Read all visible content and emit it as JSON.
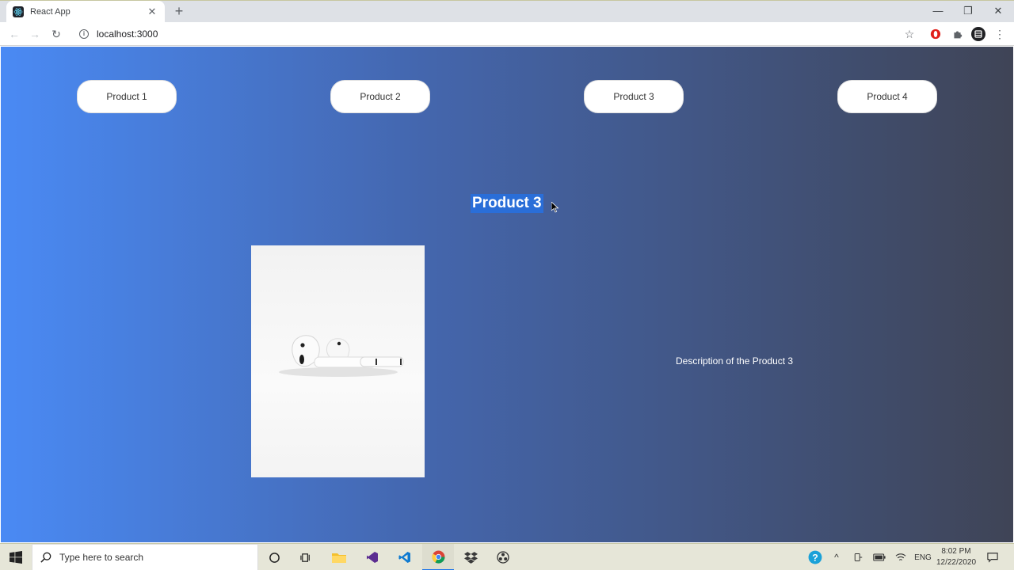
{
  "browser": {
    "tab_title": "React App",
    "tab_close": "✕",
    "new_tab": "+",
    "url": "localhost:3000",
    "window_controls": {
      "minimize": "—",
      "restore": "❐",
      "close": "✕"
    }
  },
  "page": {
    "nav_buttons": [
      {
        "label": "Product 1"
      },
      {
        "label": "Product 2"
      },
      {
        "label": "Product 3"
      },
      {
        "label": "Product 4"
      }
    ],
    "product_title": "Product 3",
    "product_description": "Description of the Product 3",
    "colors": {
      "gradient_start": "#4a8af4",
      "gradient_end": "#3f4456",
      "selection": "#2a6ed8"
    }
  },
  "taskbar": {
    "search_placeholder": "Type here to search",
    "language": "ENG",
    "time": "8:02 PM",
    "date": "12/22/2020"
  }
}
